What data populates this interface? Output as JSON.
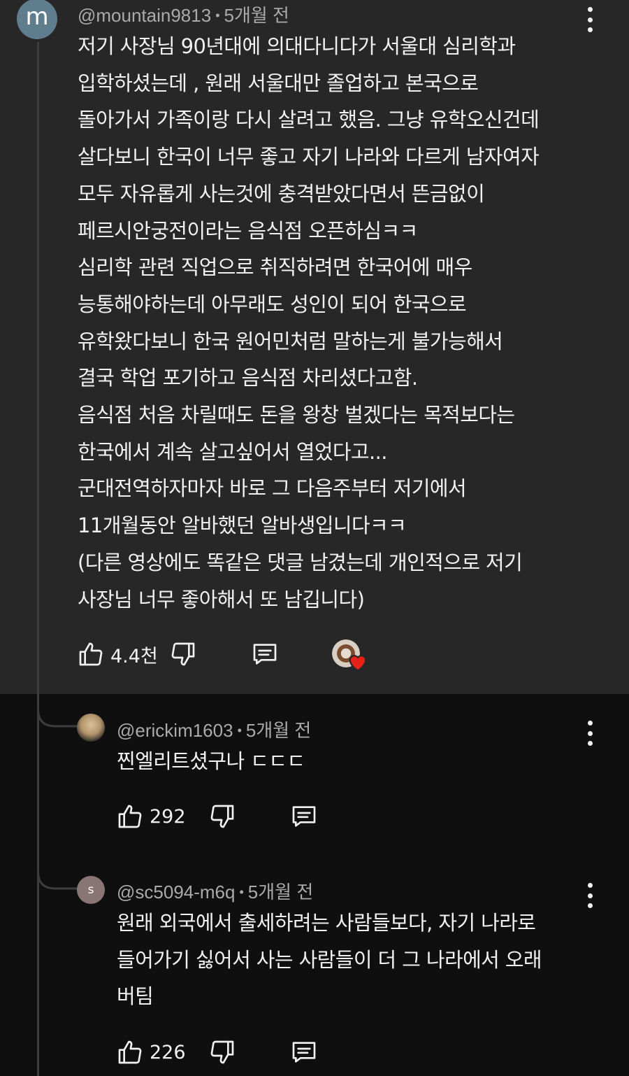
{
  "main_comment": {
    "avatar_letter": "m",
    "author": "@mountain9813",
    "time": "5개월 전",
    "lines": [
      "저기 사장님 90년대에 의대다니다가 서울대 심리학과",
      "입학하셨는데 , 원래 서울대만 졸업하고 본국으로",
      "돌아가서 가족이랑 다시 살려고 했음. 그냥 유학오신건데",
      "살다보니 한국이 너무 좋고 자기 나라와 다르게 남자여자",
      "모두 자유롭게 사는것에 충격받았다면서 뜬금없이",
      "페르시안궁전이라는 음식점 오픈하심ㅋㅋ",
      "심리학 관련 직업으로 취직하려면 한국어에 매우",
      "능통해야하는데 아무래도 성인이 되어 한국으로",
      "유학왔다보니 한국 원어민처럼 말하는게 불가능해서",
      "결국 학업 포기하고 음식점 차리셨다고함.",
      "음식점 처음 차릴때도 돈을 왕창 벌겠다는 목적보다는",
      "한국에서 계속 살고싶어서 열었다고...",
      "군대전역하자마자 바로 그 다음주부터 저기에서",
      "11개월동안 알바했던 알바생입니다ㅋㅋ",
      "(다른 영상에도 똑같은 댓글 남겼는데 개인적으로 저기",
      "사장님 너무 좋아해서 또 남깁니다)"
    ],
    "likes": "4.4천",
    "creator_heart": true
  },
  "replies": [
    {
      "author": "@erickim1603",
      "time": "5개월 전",
      "lines": [
        "찐엘리트셨구나 ㄷㄷㄷ"
      ],
      "likes": "292"
    },
    {
      "avatar_letter": "s",
      "author": "@sc5094-m6q",
      "time": "5개월 전",
      "lines": [
        "원래 외국에서 출세하려는 사람들보다, 자기 나라로",
        "들어가기 싫어서 사는 사람들이 더 그 나라에서 오래",
        "버팀"
      ],
      "likes": "226"
    }
  ],
  "icons": {
    "like": "thumbs-up-icon",
    "dislike": "thumbs-down-icon",
    "reply": "reply-comment-icon",
    "more": "more-vertical-icon",
    "heart": "creator-heart-icon"
  },
  "colors": {
    "highlight_bg": "#272727",
    "page_bg": "#0f0f0f",
    "text": "#f1f1f1",
    "meta": "#aaaaaa",
    "heart": "#e62117"
  }
}
